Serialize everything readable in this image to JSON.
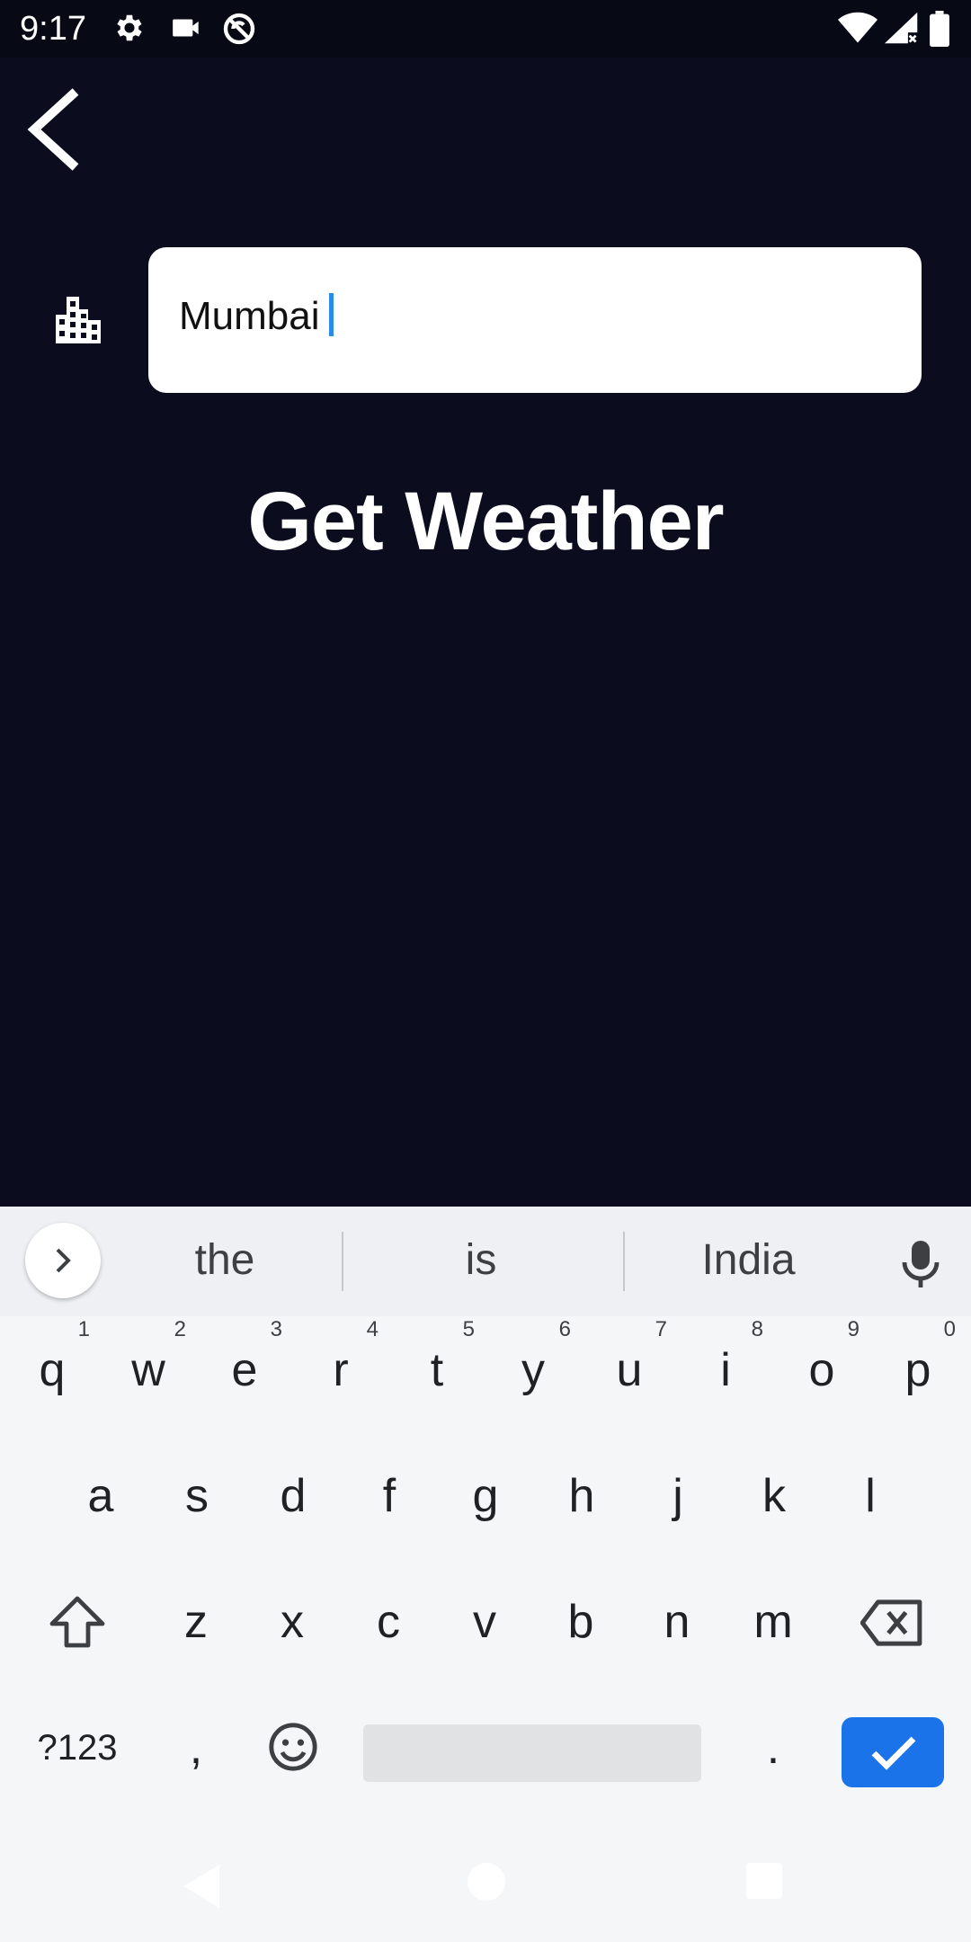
{
  "status_bar": {
    "time": "9:17",
    "icons": [
      "gear-icon",
      "camera-icon",
      "do-not-disturb-icon",
      "wifi-icon",
      "signal-icon",
      "battery-icon"
    ]
  },
  "app": {
    "back_icon": "chevron-left-icon",
    "city_icon": "building-icon",
    "city_input_value": "Mumbai",
    "get_weather_label": "Get Weather"
  },
  "keyboard": {
    "suggestions": [
      "the",
      "is",
      "India"
    ],
    "row1": [
      {
        "key": "q",
        "hint": "1"
      },
      {
        "key": "w",
        "hint": "2"
      },
      {
        "key": "e",
        "hint": "3"
      },
      {
        "key": "r",
        "hint": "4"
      },
      {
        "key": "t",
        "hint": "5"
      },
      {
        "key": "y",
        "hint": "6"
      },
      {
        "key": "u",
        "hint": "7"
      },
      {
        "key": "i",
        "hint": "8"
      },
      {
        "key": "o",
        "hint": "9"
      },
      {
        "key": "p",
        "hint": "0"
      }
    ],
    "row2": [
      "a",
      "s",
      "d",
      "f",
      "g",
      "h",
      "j",
      "k",
      "l"
    ],
    "row3": [
      "z",
      "x",
      "c",
      "v",
      "b",
      "n",
      "m"
    ],
    "symbols_label": "?123",
    "comma": ",",
    "period": "."
  },
  "colors": {
    "background": "#0b0d1f",
    "accent": "#1a73e8",
    "cursor": "#2b8be8"
  }
}
